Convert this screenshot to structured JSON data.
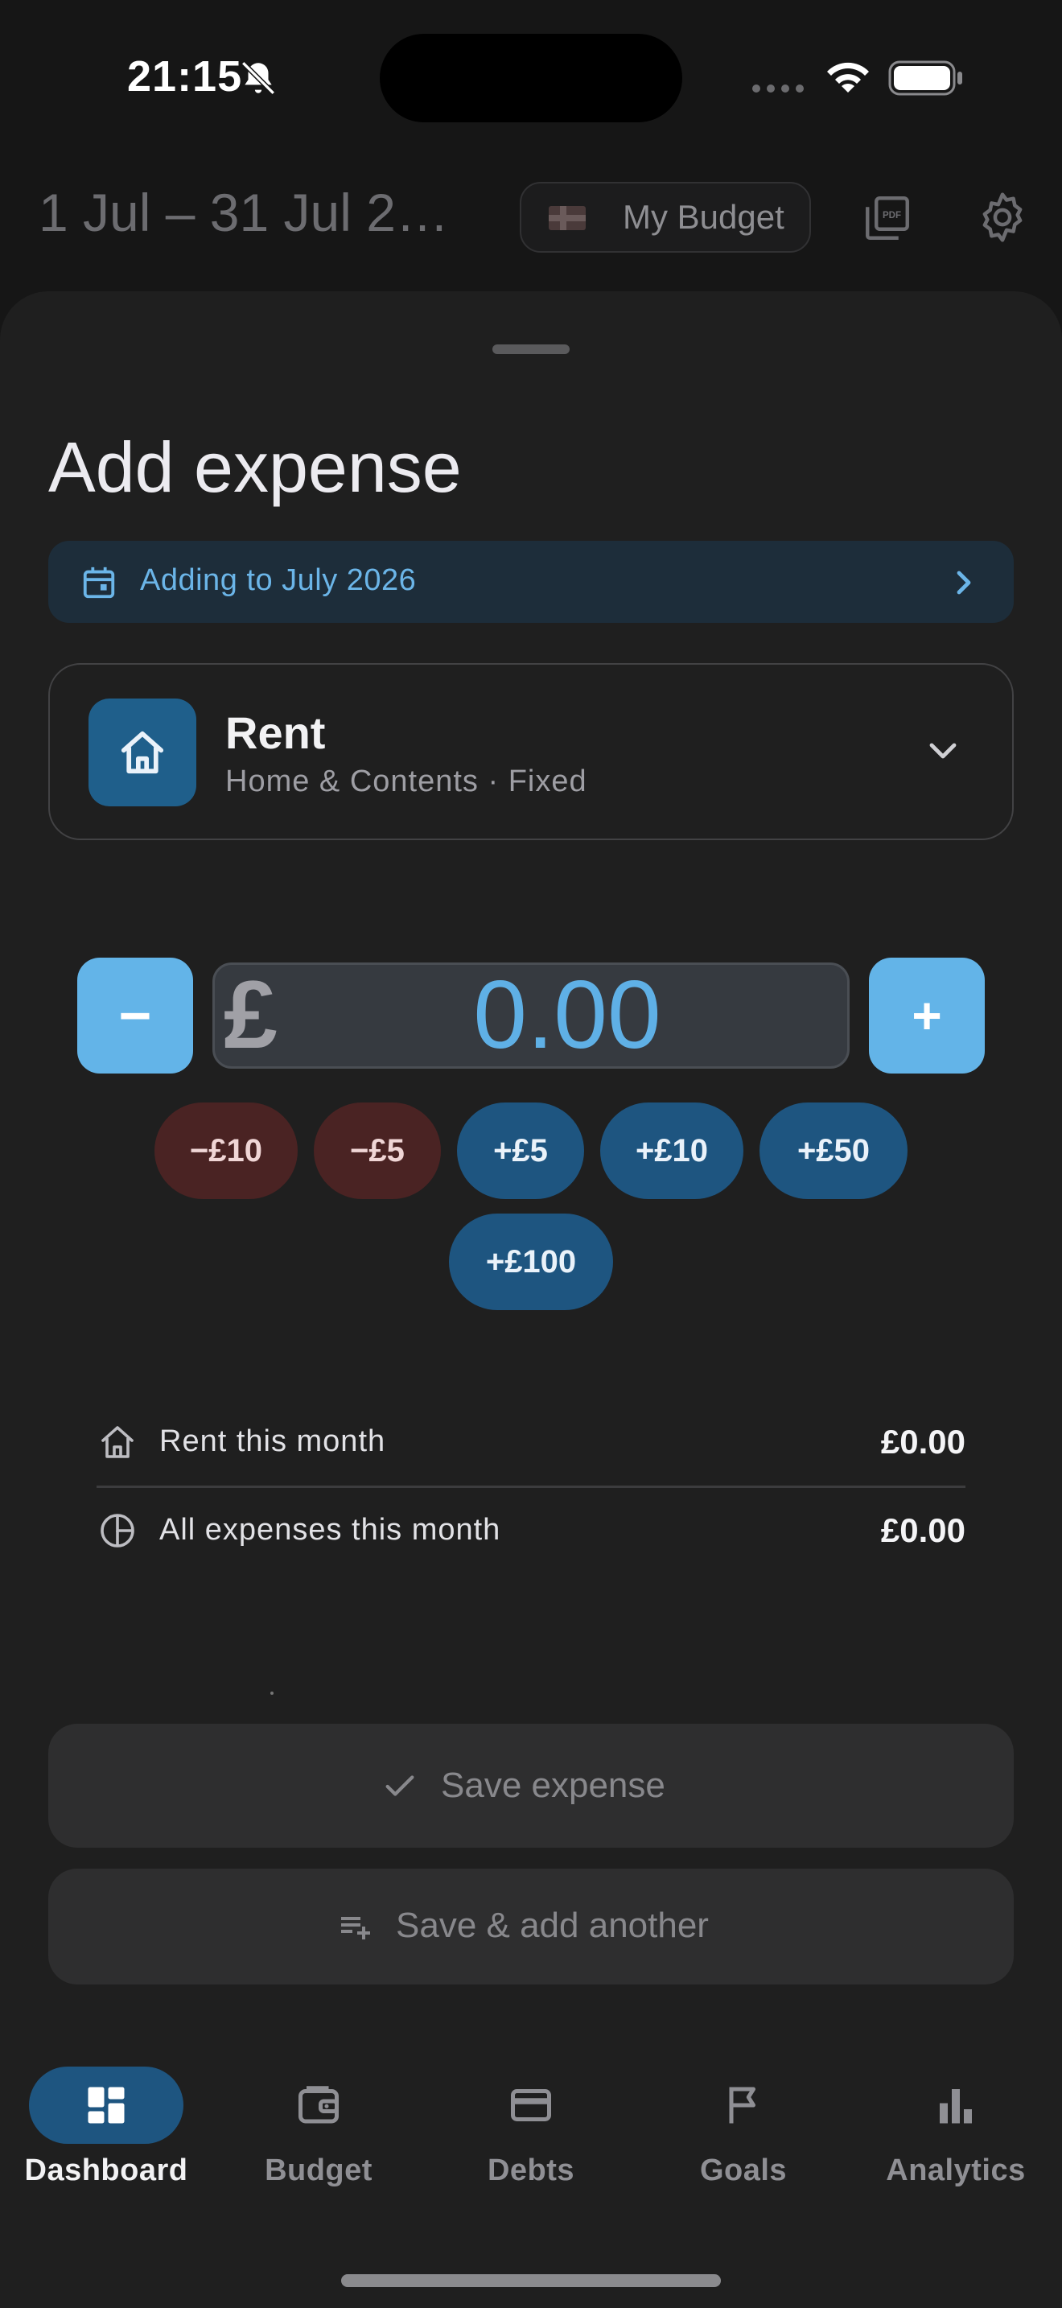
{
  "status_bar": {
    "time": "21:15",
    "icons": [
      "bell-slash-icon",
      "signal-dots-icon",
      "wifi-icon",
      "battery-icon"
    ]
  },
  "header": {
    "date_range": "1 Jul – 31 Jul 2…",
    "budget_chip_label": "My Budget",
    "icons": [
      "flag-icon",
      "pdf-icon",
      "settings-icon"
    ]
  },
  "sheet": {
    "title": "Add expense",
    "month_banner": "Adding to July 2026",
    "category": {
      "name": "Rent",
      "subtitle": "Home & Contents · Fixed",
      "icon": "home-icon"
    },
    "amount": {
      "currency_symbol": "£",
      "value": "0.00",
      "minus_label": "−",
      "plus_label": "+"
    },
    "quick_adjust": [
      "−£10",
      "−£5",
      "+£5",
      "+£10",
      "+£50",
      "+£100"
    ],
    "summary": [
      {
        "label": "Rent this month",
        "value": "£0.00",
        "icon": "home-icon"
      },
      {
        "label": "All expenses this month",
        "value": "£0.00",
        "icon": "pie-chart-icon"
      }
    ],
    "save_label": "Save expense",
    "save_add_label": "Save & add another"
  },
  "tabs": [
    {
      "label": "Dashboard",
      "icon": "dashboard-icon",
      "active": true
    },
    {
      "label": "Budget",
      "icon": "wallet-icon",
      "active": false
    },
    {
      "label": "Debts",
      "icon": "credit-card-icon",
      "active": false
    },
    {
      "label": "Goals",
      "icon": "flag-icon",
      "active": false
    },
    {
      "label": "Analytics",
      "icon": "bar-chart-icon",
      "active": false
    }
  ],
  "colors": {
    "accent": "#63b4e8",
    "accent_dark": "#1e5580",
    "negative_bg": "#4a2323",
    "sheet_bg": "#1f1f1f",
    "page_bg": "#161616"
  }
}
